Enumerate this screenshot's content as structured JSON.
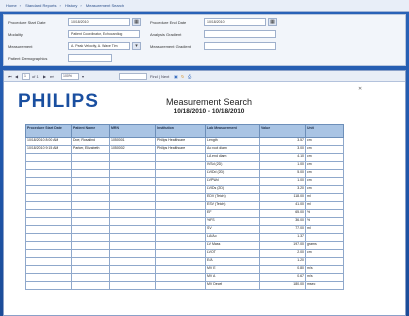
{
  "topbar": {
    "crumbs": [
      "Home",
      "Standard Reports",
      "History",
      "Measurement Search"
    ]
  },
  "filters": {
    "row1": {
      "label_a": "Procedure Start Date",
      "value_a": "10/18/2010",
      "label_b": "Procedure End Date",
      "value_b": "10/18/2010"
    },
    "row2": {
      "label_a": "Modality",
      "value_a": "Patient Coordinator, Echocardiog",
      "label_b": "Analysis Gradient",
      "value_b": ""
    },
    "row3": {
      "label_a": "Measurement",
      "value_a": "A. Peak Velocity, A. Wave Tim",
      "label_b": "Measurement Gradient",
      "value_b": ""
    },
    "row4": {
      "label_a": "Patient Demographics",
      "value_a": ""
    }
  },
  "viewer_toolbar": {
    "page_current": "1",
    "page_of": "of 1",
    "zoom": "100%",
    "find_label": "Find | Next"
  },
  "report": {
    "logo": "PHILIPS",
    "title": "Measurement Search",
    "range": "10/18/2010 - 10/18/2010",
    "columns": [
      "Procedure Start Date",
      "Patient Name",
      "MRN",
      "Institution",
      "Lab Measurement",
      "Value",
      "Unit"
    ],
    "rows": [
      {
        "date": "10/18/2010 8:00 AM",
        "patient": "Doe, Rosalind",
        "mrn": "1050001",
        "inst": "Philips Healthcare",
        "meas": "Length",
        "value": "3.57",
        "unit": "cm"
      },
      {
        "date": "10/18/2010 9:15 AM",
        "patient": "Parker, Elizabeth",
        "mrn": "1050002",
        "inst": "Philips Healthcare",
        "meas": "Ao root diam",
        "value": "3.00",
        "unit": "cm"
      },
      {
        "date": "",
        "patient": "",
        "mrn": "",
        "inst": "",
        "meas": "LA end diam",
        "value": "4.10",
        "unit": "cm"
      },
      {
        "date": "",
        "patient": "",
        "mrn": "",
        "inst": "",
        "meas": "IVSd (2D)",
        "value": "1.00",
        "unit": "cm"
      },
      {
        "date": "",
        "patient": "",
        "mrn": "",
        "inst": "",
        "meas": "LVIDd (2D)",
        "value": "5.00",
        "unit": "cm"
      },
      {
        "date": "",
        "patient": "",
        "mrn": "",
        "inst": "",
        "meas": "LVPWd",
        "value": "1.00",
        "unit": "cm"
      },
      {
        "date": "",
        "patient": "",
        "mrn": "",
        "inst": "",
        "meas": "LVIDs (2D)",
        "value": "3.20",
        "unit": "cm"
      },
      {
        "date": "",
        "patient": "",
        "mrn": "",
        "inst": "",
        "meas": "EDV (Teich)",
        "value": "118.00",
        "unit": "ml"
      },
      {
        "date": "",
        "patient": "",
        "mrn": "",
        "inst": "",
        "meas": "ESV (Teich)",
        "value": "41.00",
        "unit": "ml"
      },
      {
        "date": "",
        "patient": "",
        "mrn": "",
        "inst": "",
        "meas": "EF",
        "value": "65.00",
        "unit": "%"
      },
      {
        "date": "",
        "patient": "",
        "mrn": "",
        "inst": "",
        "meas": "%FS",
        "value": "36.00",
        "unit": "%"
      },
      {
        "date": "",
        "patient": "",
        "mrn": "",
        "inst": "",
        "meas": "SV",
        "value": "77.00",
        "unit": "ml"
      },
      {
        "date": "",
        "patient": "",
        "mrn": "",
        "inst": "",
        "meas": "LA/Ao",
        "value": "1.37",
        "unit": ""
      },
      {
        "date": "",
        "patient": "",
        "mrn": "",
        "inst": "",
        "meas": "LV Mass",
        "value": "197.00",
        "unit": "grams"
      },
      {
        "date": "",
        "patient": "",
        "mrn": "",
        "inst": "",
        "meas": "LVOT",
        "value": "2.00",
        "unit": "cm"
      },
      {
        "date": "",
        "patient": "",
        "mrn": "",
        "inst": "",
        "meas": "E/A",
        "value": "1.20",
        "unit": ""
      },
      {
        "date": "",
        "patient": "",
        "mrn": "",
        "inst": "",
        "meas": "MV E",
        "value": "0.80",
        "unit": "m/s"
      },
      {
        "date": "",
        "patient": "",
        "mrn": "",
        "inst": "",
        "meas": "MV A",
        "value": "0.67",
        "unit": "m/s"
      },
      {
        "date": "",
        "patient": "",
        "mrn": "",
        "inst": "",
        "meas": "MV Decel",
        "value": "180.00",
        "unit": "msec"
      }
    ]
  },
  "colors": {
    "background": "#2a63b8",
    "header_fill": "#a9c4e4",
    "logo": "#1a4fa0"
  }
}
